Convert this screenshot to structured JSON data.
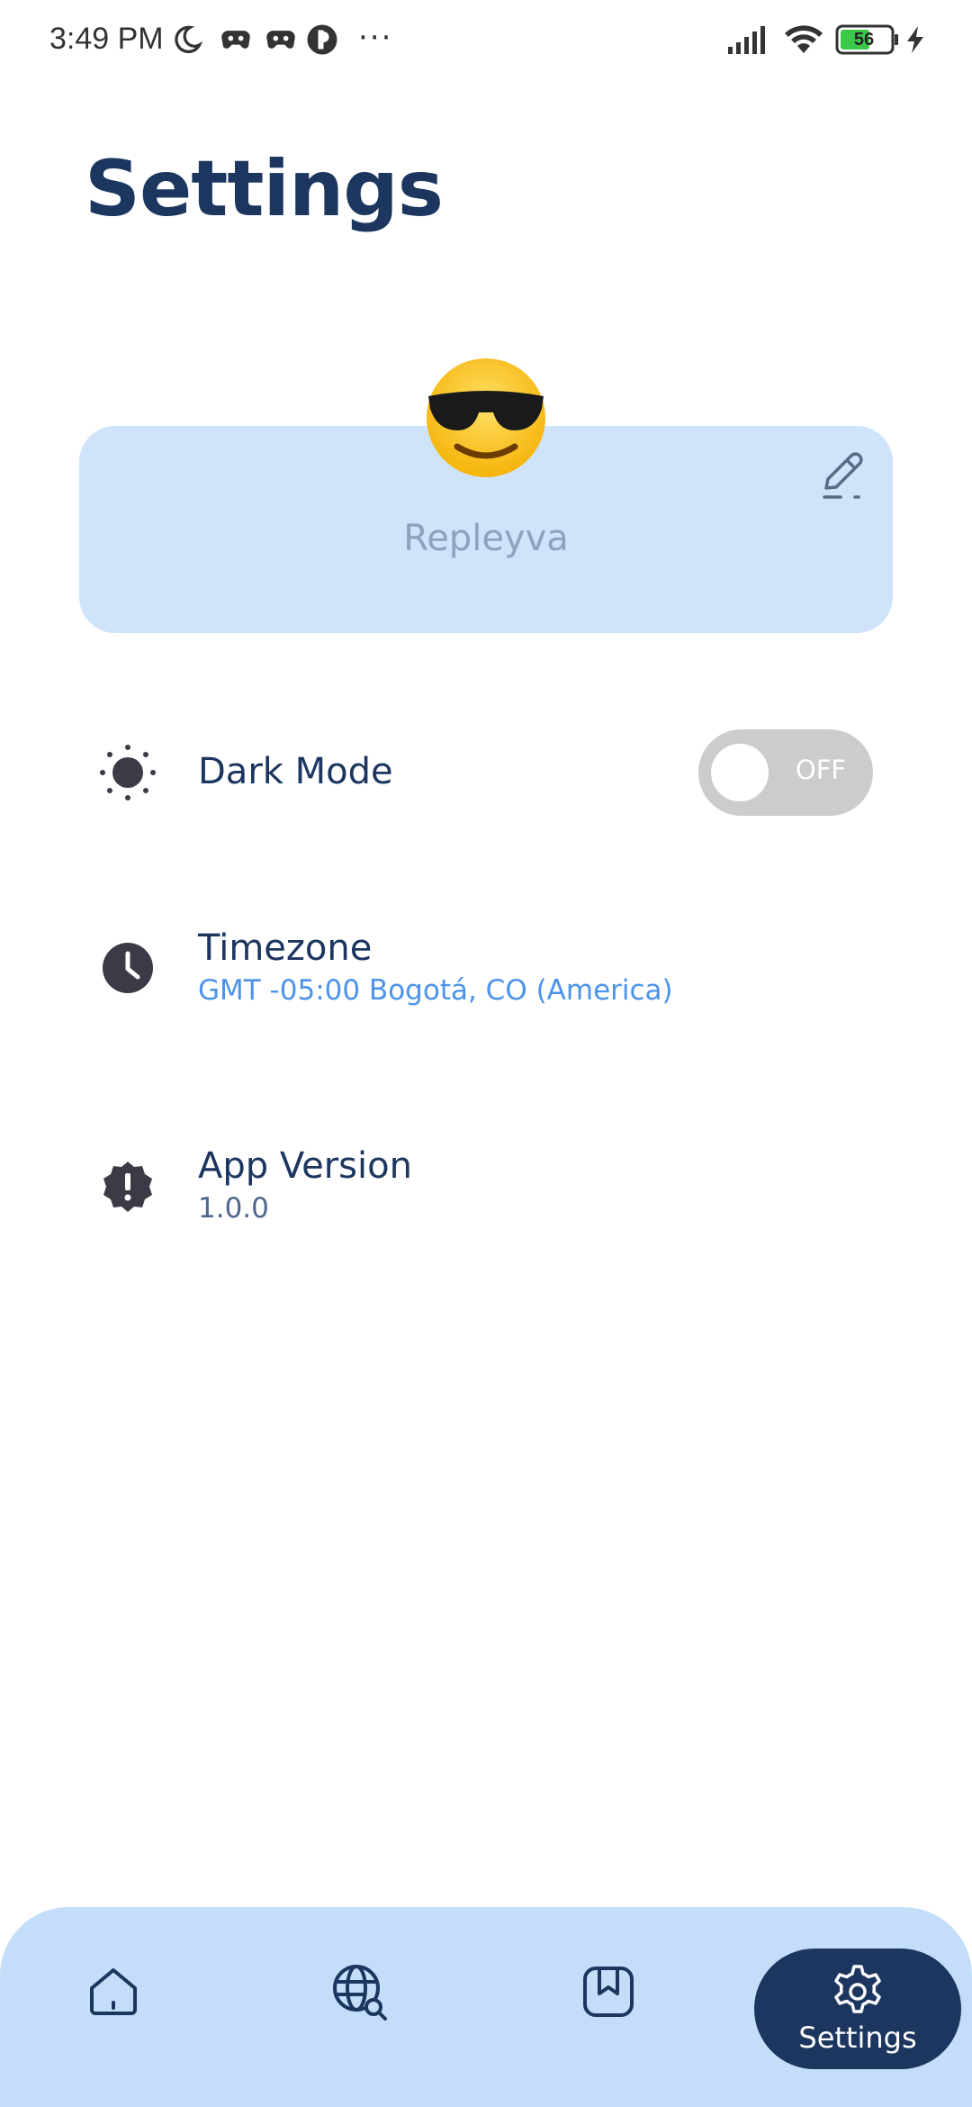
{
  "status_bar": {
    "time": "3:49 PM",
    "battery": "56",
    "icons": [
      "moon-icon",
      "game-controller-icon",
      "game-controller-icon",
      "app-icon",
      "more-dots-icon",
      "signal-icon",
      "wifi-icon",
      "battery-icon",
      "charging-icon"
    ],
    "more": "···"
  },
  "page": {
    "title": "Settings"
  },
  "profile": {
    "avatar_emoji": "😎",
    "name": "Repleyva",
    "edit_icon": "pencil-icon"
  },
  "settings": {
    "dark_mode": {
      "label": "Dark Mode",
      "toggle_state": "OFF",
      "icon": "sun-icon"
    },
    "timezone": {
      "label": "Timezone",
      "value": "GMT -05:00 Bogotá, CO (America)",
      "icon": "clock-icon"
    },
    "app_version": {
      "label": "App Version",
      "value": "1.0.0",
      "icon": "alert-badge-icon"
    }
  },
  "bottom_nav": {
    "items": [
      {
        "icon": "home-icon"
      },
      {
        "icon": "globe-search-icon"
      },
      {
        "icon": "bookmark-icon"
      },
      {
        "icon": "gear-icon",
        "label": "Settings",
        "active": true
      }
    ]
  },
  "colors": {
    "primary": "#1c3660",
    "card_bg": "#cfe3fb",
    "nav_bg": "#c4ddf8",
    "link_blue": "#4c93ea",
    "toggle_off": "#cccccc"
  }
}
